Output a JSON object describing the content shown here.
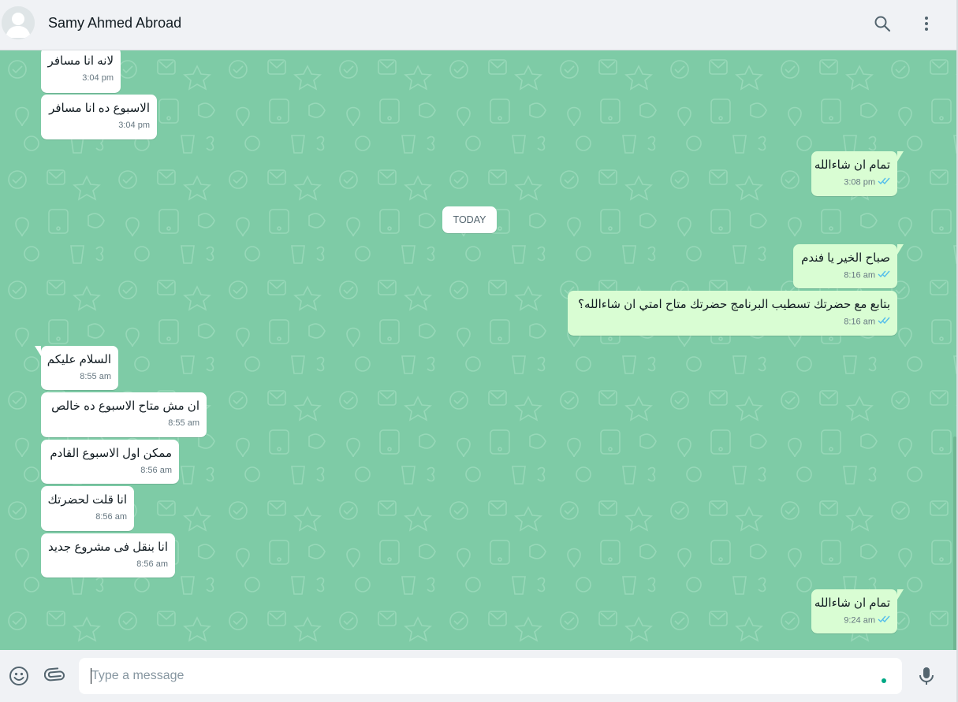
{
  "header": {
    "contact_name": "Samy Ahmed Abroad",
    "icons": [
      "avatar-icon",
      "search-icon",
      "menu-icon"
    ]
  },
  "chat": {
    "date_divider": "TODAY",
    "messages": [
      {
        "dir": "in",
        "text": "لانه انا مسافر",
        "time": "3:04 pm"
      },
      {
        "dir": "in",
        "text": "الاسبوع ده انا مسافر",
        "time": "3:04 pm"
      },
      {
        "dir": "out",
        "text": "تمام ان شاءالله",
        "time": "3:08 pm",
        "read": true
      },
      {
        "dir": "out",
        "text": "صباح الخير يا فندم",
        "time": "8:16 am",
        "read": true
      },
      {
        "dir": "out",
        "text": "بتابع مع حضرتك تسطيب البرنامج حضرتك متاح امتي ان شاءالله؟",
        "time": "8:16 am",
        "read": true
      },
      {
        "dir": "in",
        "text": "السلام عليكم",
        "time": "8:55 am"
      },
      {
        "dir": "in",
        "text": "ان مش متاح الاسبوع ده خالص",
        "time": "8:55 am"
      },
      {
        "dir": "in",
        "text": "ممكن اول الاسبوع القادم",
        "time": "8:56 am"
      },
      {
        "dir": "in",
        "text": "انا قلت لحضرتك",
        "time": "8:56 am"
      },
      {
        "dir": "in",
        "text": "انا بنقل فى مشروع جديد",
        "time": "8:56 am"
      },
      {
        "dir": "out",
        "text": "تمام ان شاءالله",
        "time": "9:24 am",
        "read": true
      }
    ]
  },
  "footer": {
    "placeholder": "Type a message",
    "value": "",
    "icons": [
      "emoji-icon",
      "attach-icon",
      "mic-icon"
    ]
  },
  "colors": {
    "chat_background": "#7ecba6",
    "incoming_bubble": "#ffffff",
    "outgoing_bubble": "#d9fdd3",
    "read_ticks": "#53bdeb",
    "accent": "#00a884"
  }
}
